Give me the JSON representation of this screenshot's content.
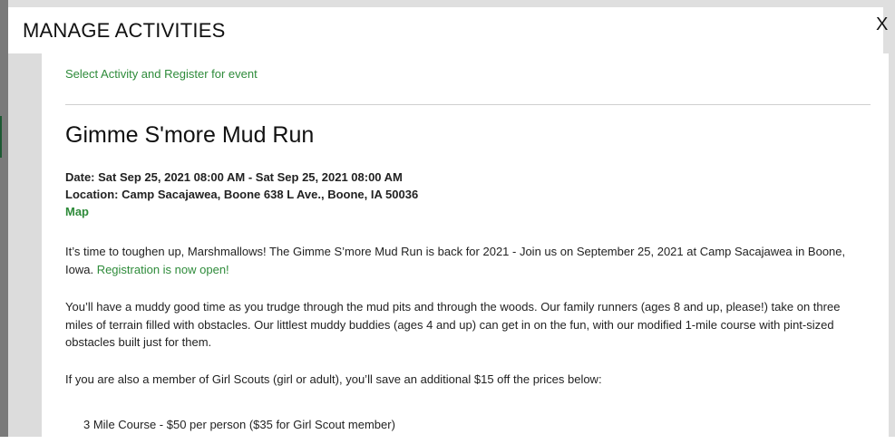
{
  "modal": {
    "title": "MANAGE ACTIVITIES",
    "close_label": "X"
  },
  "nav": {
    "select_link": "Select Activity and Register for event"
  },
  "event": {
    "title": "Gimme S'more Mud Run",
    "date_line": "Date: Sat Sep 25, 2021 08:00 AM - Sat Sep 25, 2021 08:00 AM",
    "location_line": "Location: Camp Sacajawea, Boone 638 L Ave., Boone, IA 50036",
    "map_link": "Map"
  },
  "description": {
    "p1_text": "It’s time to toughen up, Marshmallows! The Gimme S’more Mud Run is back for 2021 - Join us on September 25, 2021 at Camp Sacajawea in Boone, Iowa. ",
    "p1_link": "Registration is now open!",
    "p2": "You’ll have a muddy good time as you trudge through the mud pits and through the woods. Our family runners (ages 8 and up, please!) take on three miles of terrain filled with obstacles.  Our littlest muddy buddies (ages 4 and up) can get in on the fun, with our modified 1-mile course with pint-sized obstacles built just for them.",
    "p3": "If you are also a member of Girl Scouts (girl or adult), you’ll save an additional $15 off the prices below:",
    "course_1": "3 Mile Course - $50 per person ($35 for Girl Scout member)"
  },
  "colors": {
    "link_green": "#2e8b3a",
    "backdrop_gray": "#dcdcdc"
  }
}
